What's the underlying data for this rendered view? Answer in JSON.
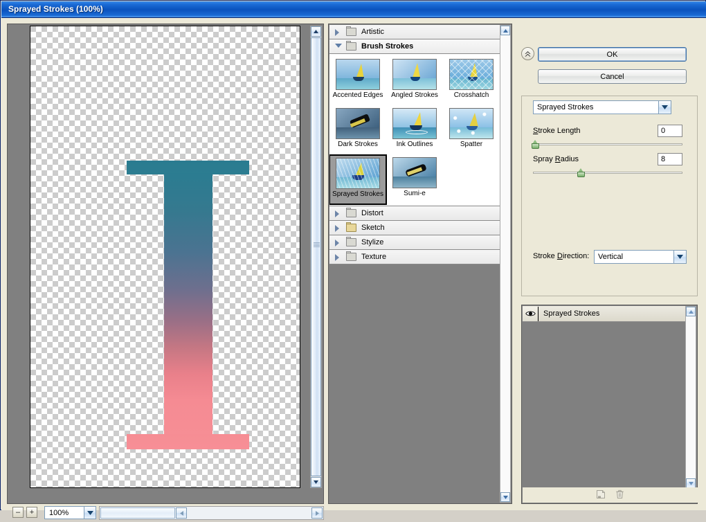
{
  "window": {
    "title": "Sprayed Strokes (100%)"
  },
  "preview": {
    "zoom_value": "100%",
    "zoom_out_label": "–",
    "zoom_in_label": "+",
    "letter": "I",
    "gradient_top": "#2b7c91",
    "gradient_bottom": "#f68e95"
  },
  "filter_tree": {
    "categories": [
      {
        "name": "Artistic",
        "expanded": false,
        "folder_color": "gray"
      },
      {
        "name": "Brush Strokes",
        "expanded": true,
        "folder_color": "gray"
      },
      {
        "name": "Distort",
        "expanded": false,
        "folder_color": "gray"
      },
      {
        "name": "Sketch",
        "expanded": false,
        "folder_color": "yellow"
      },
      {
        "name": "Stylize",
        "expanded": false,
        "folder_color": "gray"
      },
      {
        "name": "Texture",
        "expanded": false,
        "folder_color": "gray"
      }
    ],
    "filters": [
      {
        "name": "Accented Edges",
        "selected": false
      },
      {
        "name": "Angled Strokes",
        "selected": false
      },
      {
        "name": "Crosshatch",
        "selected": false
      },
      {
        "name": "Dark Strokes",
        "selected": false
      },
      {
        "name": "Ink Outlines",
        "selected": false
      },
      {
        "name": "Spatter",
        "selected": false
      },
      {
        "name": "Sprayed Strokes",
        "selected": true
      },
      {
        "name": "Sumi-e",
        "selected": false
      }
    ]
  },
  "settings": {
    "ok_label": "OK",
    "cancel_label": "Cancel",
    "collapse_icon": "double-chevron-up-icon",
    "filter_select": {
      "value": "Sprayed Strokes"
    },
    "params": [
      {
        "label_pre": "S",
        "label_post": "troke Length",
        "value": "0",
        "percent": 0
      },
      {
        "label_pre": "Spray ",
        "label_post": "R",
        "label_tail": "adius",
        "value": "8",
        "percent": 32
      }
    ],
    "stroke_length": {
      "label": "Stroke Length",
      "accel": "S",
      "value": "0",
      "percent": 0
    },
    "spray_radius": {
      "label": "Spray Radius",
      "accel": "R",
      "value": "8",
      "percent": 32
    },
    "stroke_direction": {
      "label": "Stroke Direction:",
      "accel": "D",
      "value": "Vertical"
    }
  },
  "effect_layers": {
    "rows": [
      {
        "name": "Sprayed Strokes",
        "visible": true,
        "visibility_icon": "eye-icon"
      }
    ],
    "new_layer_icon": "new-effect-layer-icon",
    "delete_icon": "trash-icon"
  }
}
